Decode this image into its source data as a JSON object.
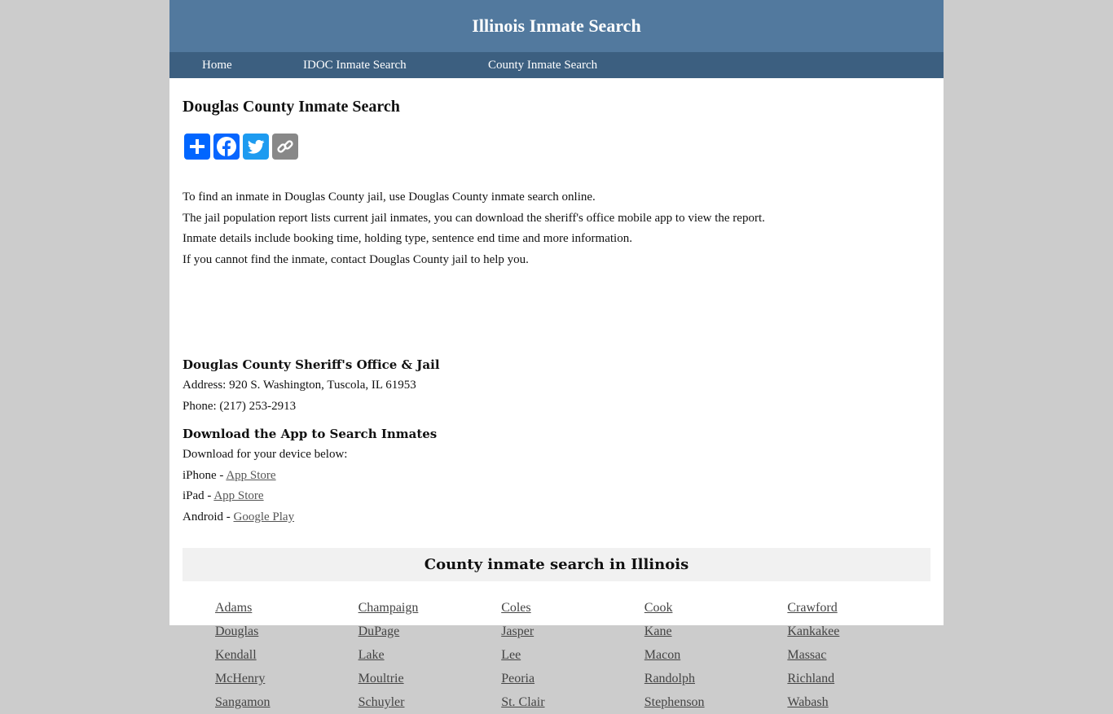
{
  "header": {
    "title": "Illinois Inmate Search"
  },
  "nav": [
    {
      "label": "Home"
    },
    {
      "label": "IDOC Inmate Search"
    },
    {
      "label": "County Inmate Search"
    }
  ],
  "page": {
    "title": "Douglas County Inmate Search",
    "share": [
      {
        "name": "share",
        "color": "#0166ff"
      },
      {
        "name": "facebook",
        "color": "#0866ff"
      },
      {
        "name": "twitter",
        "color": "#1d9bf0"
      },
      {
        "name": "copy-link",
        "color": "#888888"
      }
    ],
    "intro": [
      "To find an inmate in Douglas County jail, use Douglas County inmate search online.",
      "The jail population report lists current jail inmates, you can download the sheriff's office mobile app to view the report.",
      "Inmate details include booking time, holding type, sentence end time and more information.",
      "If you cannot find the inmate, contact Douglas County jail to help you."
    ],
    "office": {
      "heading": "Douglas County Sheriff's Office & Jail",
      "address": "Address: 920 S. Washington, Tuscola, IL 61953",
      "phone": "Phone: (217) 253-2913"
    },
    "app": {
      "heading": "Download the App to Search Inmates",
      "subtitle": "Download for your device below:",
      "devices": [
        {
          "device": "iPhone - ",
          "link": "App Store"
        },
        {
          "device": "iPad - ",
          "link": "App Store"
        },
        {
          "device": "Android - ",
          "link": "Google Play"
        }
      ]
    }
  },
  "counties": {
    "heading": "County inmate search in Illinois",
    "items": [
      "Adams",
      "Champaign",
      "Coles",
      "Cook",
      "Crawford",
      "Douglas",
      "DuPage",
      "Jasper",
      "Kane",
      "Kankakee",
      "Kendall",
      "Lake",
      "Lee",
      "Macon",
      "Massac",
      "McHenry",
      "Moultrie",
      "Peoria",
      "Randolph",
      "Richland",
      "Sangamon",
      "Schuyler",
      "St. Clair",
      "Stephenson",
      "Wabash"
    ]
  }
}
